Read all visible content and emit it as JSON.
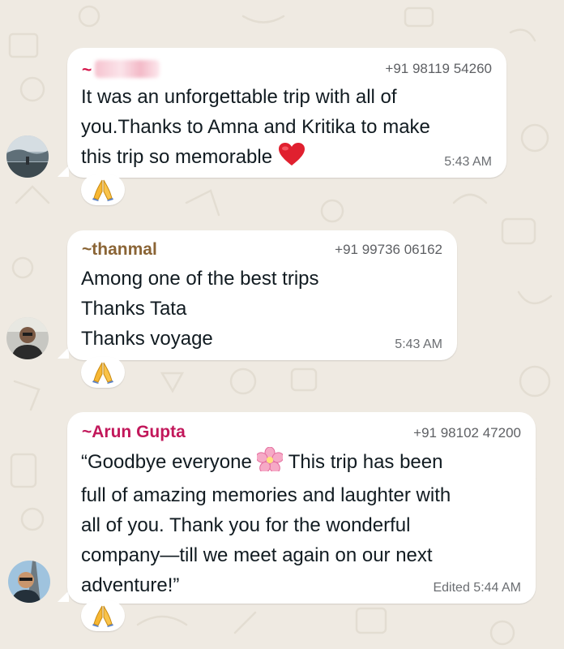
{
  "messages": [
    {
      "sender_prefix": "~",
      "sender": "",
      "sender_blurred": true,
      "phone": "+91 98119 54260",
      "lines": [
        "It was an unforgettable trip with all of",
        "you.Thanks to Amna and Kritika to make",
        "this trip so memorable"
      ],
      "inline_emoji": "heart-emoji",
      "time": "5:43 AM",
      "reaction": "folded-hands-emoji",
      "sender_color": "#d5154a"
    },
    {
      "sender_prefix": "~",
      "sender": "thanmal",
      "phone": "+91 99736 06162",
      "lines": [
        "Among one of the best trips",
        "Thanks Tata",
        "Thanks voyage"
      ],
      "time": "5:43 AM",
      "reaction": "folded-hands-emoji",
      "sender_color": "#8a6435"
    },
    {
      "sender_prefix": "~",
      "sender": "Arun Gupta",
      "phone": "+91 98102 47200",
      "lines_parts": {
        "l1a": "“Goodbye everyone",
        "l1b": "This trip has been"
      },
      "lines": [
        "full of amazing memories and laughter with",
        "all of you. Thank you for the wonderful",
        "company—till we meet again on our next",
        "adventure!”"
      ],
      "inline_emoji": "cherry-blossom-emoji",
      "edited_label": "Edited",
      "time": "5:44 AM",
      "reaction": "folded-hands-emoji",
      "sender_color": "#c2185b"
    }
  ],
  "colors": {
    "background": "#efeae2",
    "bubble": "#ffffff",
    "text": "#111b21",
    "meta": "#6b6e72"
  }
}
